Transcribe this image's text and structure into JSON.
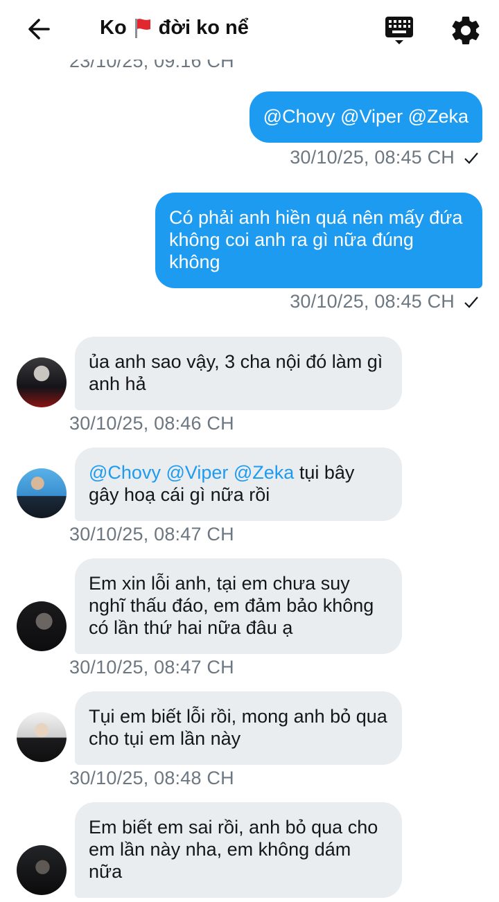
{
  "header": {
    "title": "Ko",
    "title_suffix": "đời ko nể",
    "icons": [
      "back-arrow-icon",
      "flag-icon",
      "keyboard-icon",
      "gear-icon"
    ]
  },
  "partial_timestamp": "23/10/25, 09:16 CH",
  "messages": [
    {
      "side": "out",
      "text": "@Chovy @Viper @Zeka",
      "time": "30/10/25, 08:45 CH"
    },
    {
      "side": "out",
      "text": "Có phải anh hiền quá nên mấy đứa không coi anh ra gì nữa đúng không",
      "time": "30/10/25, 08:45 CH"
    },
    {
      "side": "in",
      "text": "ủa anh sao vậy, 3 cha nội đó làm gì anh hả",
      "time": "30/10/25, 08:46 CH"
    },
    {
      "side": "in",
      "mentions": "@Chovy @Viper @Zeka",
      "text": " tụi bây gây hoạ cái gì nữa rồi",
      "time": "30/10/25, 08:47 CH"
    },
    {
      "side": "in",
      "text": "Em xin lỗi anh, tại em chưa suy nghĩ thấu đáo, em đảm bảo không có lần thứ hai nữa đâu ạ",
      "time": "30/10/25, 08:47 CH"
    },
    {
      "side": "in",
      "text": "Tụi em biết lỗi rồi, mong anh bỏ qua cho tụi em lần này",
      "time": "30/10/25, 08:48 CH"
    },
    {
      "side": "in",
      "text": "Em biết em sai rồi, anh bỏ qua cho em lần này nha, em không dám nữa"
    }
  ],
  "colors": {
    "outgoing_bubble": "#1d9bf0",
    "incoming_bubble": "#e9edf0",
    "timestamp": "#6c7781",
    "mention": "#1d9bf0"
  }
}
